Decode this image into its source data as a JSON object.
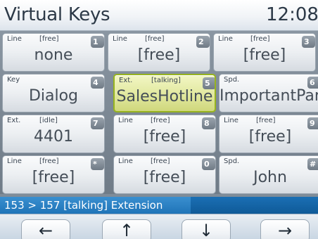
{
  "header": {
    "title": "Virtual Keys",
    "clock": "12:08"
  },
  "keys": [
    {
      "type": "Line",
      "state": "[free]",
      "num": "1",
      "label": "none",
      "active": false
    },
    {
      "type": "Line",
      "state": "[free]",
      "num": "2",
      "label": "[free]",
      "active": false
    },
    {
      "type": "Line",
      "state": "[free]",
      "num": "3",
      "label": "[free]",
      "active": false
    },
    {
      "type": "Key",
      "state": "",
      "num": "4",
      "label": "Dialog",
      "active": false
    },
    {
      "type": "Ext.",
      "state": "[talking]",
      "num": "5",
      "label": "SalesHotline",
      "active": true
    },
    {
      "type": "Spd.",
      "state": "",
      "num": "6",
      "label": "ImportantPartner",
      "active": false
    },
    {
      "type": "Ext.",
      "state": "[idle]",
      "num": "7",
      "label": "4401",
      "active": false
    },
    {
      "type": "Line",
      "state": "[free]",
      "num": "8",
      "label": "[free]",
      "active": false
    },
    {
      "type": "Line",
      "state": "[free]",
      "num": "9",
      "label": "[free]",
      "active": false
    },
    {
      "type": "Line",
      "state": "[free]",
      "num": "*",
      "label": "[free]",
      "active": false
    },
    {
      "type": "Line",
      "state": "[free]",
      "num": "0",
      "label": "[free]",
      "active": false
    },
    {
      "type": "Spd.",
      "state": "",
      "num": "#",
      "label": "John",
      "active": false
    }
  ],
  "status": {
    "text": "153 > 157 [talking] Extension",
    "progress": 0.6
  },
  "nav": {
    "left": {
      "label": "←",
      "icon": "arrow-left-icon"
    },
    "up": {
      "label": "↑",
      "icon": "arrow-up-icon"
    },
    "down": {
      "label": "↓",
      "icon": "arrow-down-icon"
    },
    "right": {
      "label": "→",
      "icon": "arrow-right-icon"
    }
  },
  "colors": {
    "active_key_border": "#97b31f",
    "status_bar": "#0f5a98"
  }
}
